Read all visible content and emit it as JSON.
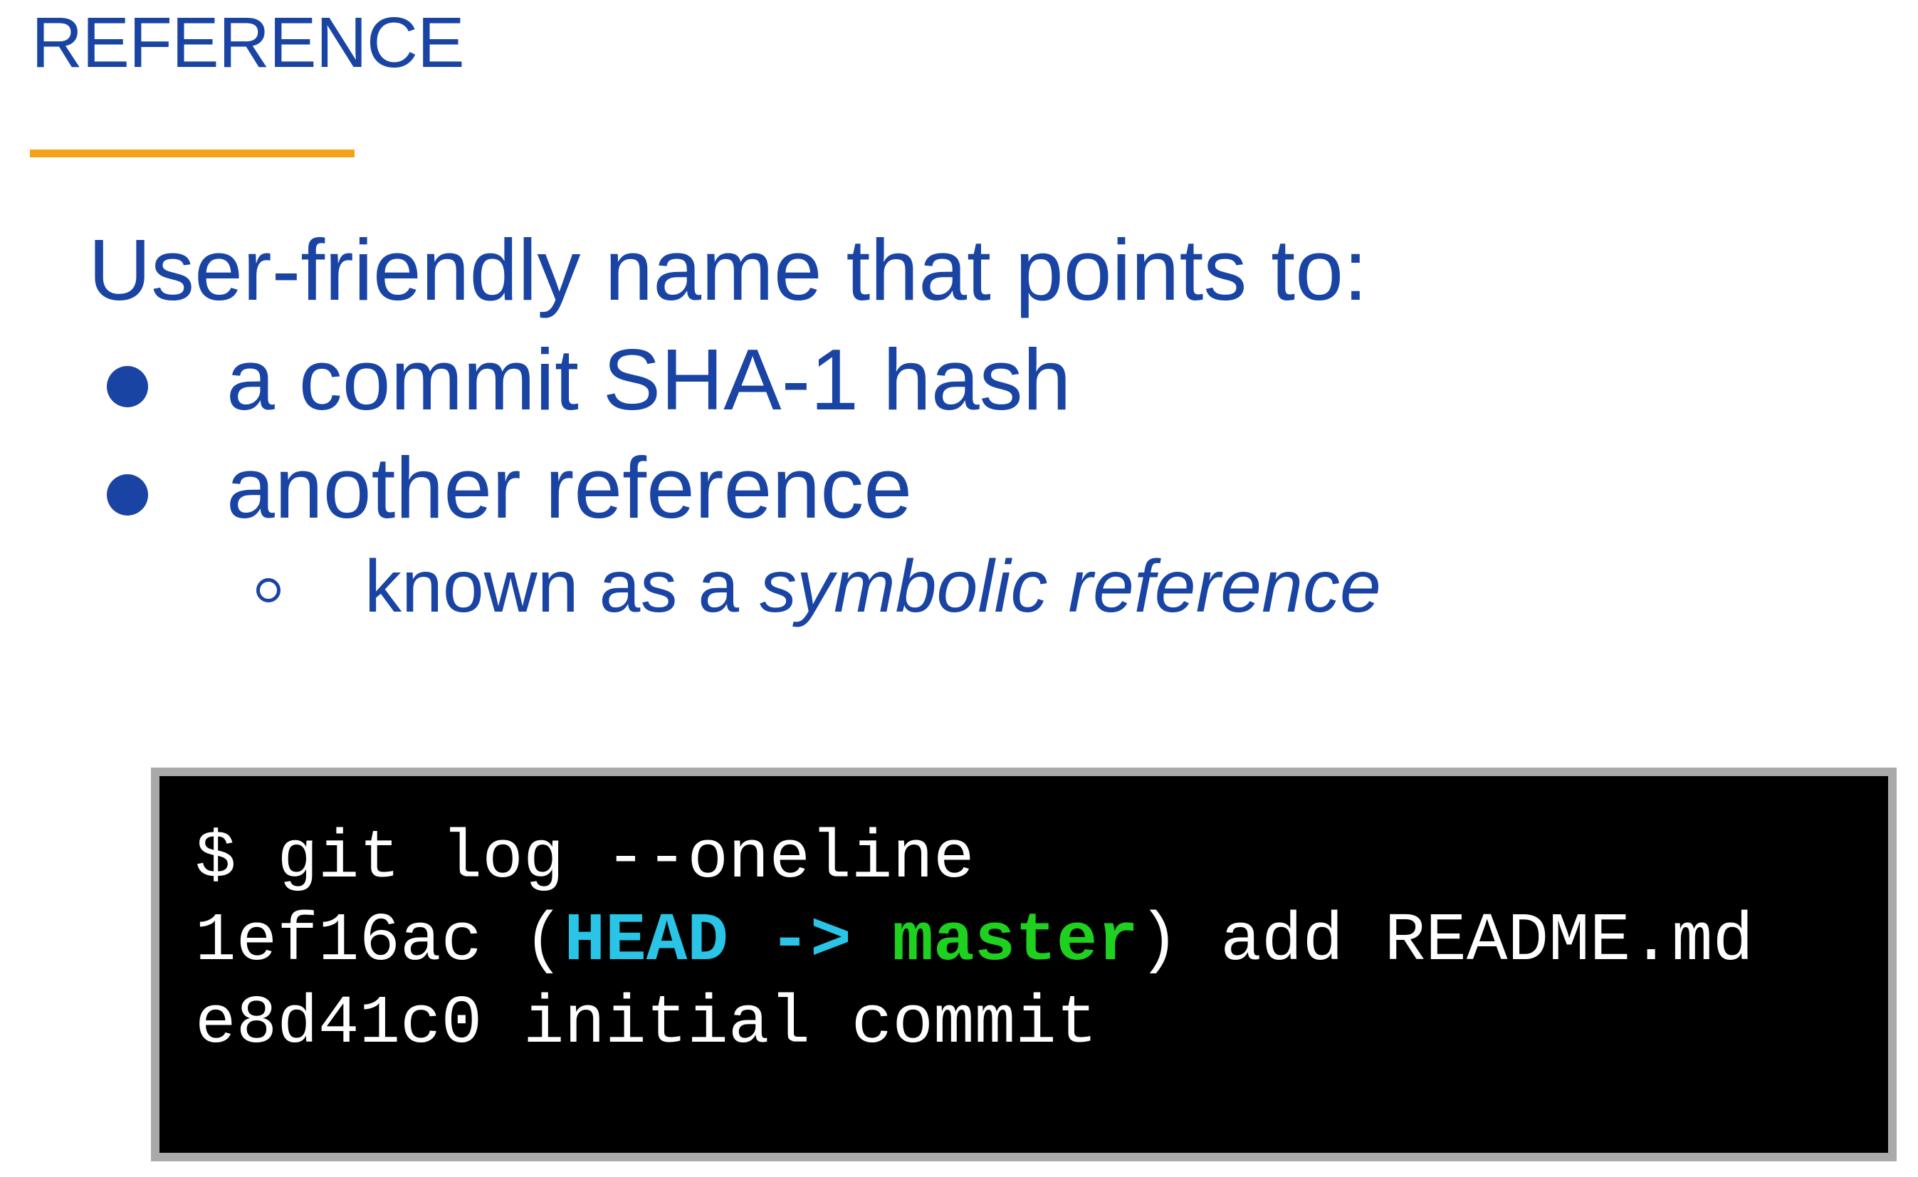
{
  "slide": {
    "title": "REFERENCE",
    "lead": "User-friendly name that points to:",
    "bullets": [
      "a commit SHA-1 hash",
      "another reference"
    ],
    "sub_bullet": {
      "prefix": "known as a ",
      "emphasis": "symbolic reference"
    }
  },
  "terminal": {
    "command": "$ git log --oneline",
    "commits": [
      {
        "hash": "1ef16ac",
        "open_paren": "(",
        "head": "HEAD",
        "arrow": "->",
        "branch": "master",
        "close_paren": ")",
        "message": "add README.md"
      },
      {
        "hash": "e8d41c0",
        "message": "initial commit"
      }
    ]
  },
  "colors": {
    "text_blue": "#1a44a3",
    "rule_orange": "#f4a21a",
    "terminal_bg": "#000000",
    "terminal_border": "#a9a9a9",
    "head_cyan": "#29c4e6",
    "branch_green": "#1fd11f"
  },
  "icons": {
    "bullet": "filled-circle-bullet-icon",
    "sub_bullet": "hollow-circle-bullet-icon"
  }
}
